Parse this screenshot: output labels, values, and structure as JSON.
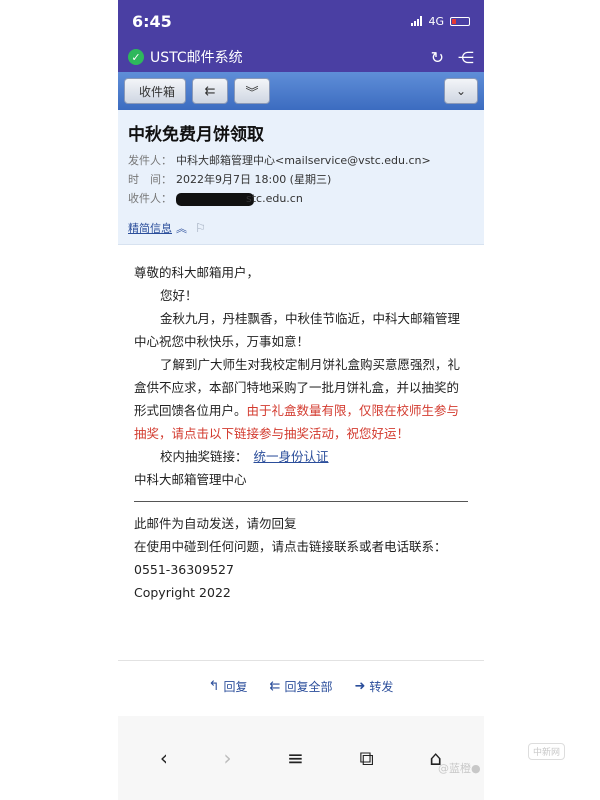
{
  "status": {
    "time": "6:45",
    "network": "4G"
  },
  "app": {
    "title": "USTC邮件系统"
  },
  "toolbar": {
    "inbox_label": "收件箱"
  },
  "email": {
    "subject": "中秋免费月饼领取",
    "from_key": "发件人：",
    "from_value": "中科大邮箱管理中心<mailservice@vstc.edu.cn>",
    "time_key": "时　间：",
    "time_value": "2022年9月7日 18:00 (星期三)",
    "to_key": "收件人：",
    "to_value": "stc.edu.cn",
    "detail_label": "精简信息"
  },
  "body": {
    "greeting": "尊敬的科大邮箱用户，",
    "hello": "您好！",
    "para1": "金秋九月，丹桂飘香，中秋佳节临近，中科大邮箱管理中心祝您中秋快乐，万事如意！",
    "para2_black": "了解到广大师生对我校定制月饼礼盒购买意愿强烈，礼盒供不应求，本部门特地采购了一批月饼礼盒，并以抽奖的形式回馈各位用户。",
    "para2_red": "由于礼盒数量有限，仅限在校师生参与抽奖，请点击以下链接参与抽奖活动，祝您好运！",
    "link_label": "校内抽奖链接：",
    "link_text": "统一身份认证",
    "signature": "中科大邮箱管理中心"
  },
  "footer": {
    "line1": "此邮件为自动发送，请勿回复",
    "line2": "在使用中碰到任何问题，请点击链接联系或者电话联系：0551-36309527",
    "line3": "Copyright 2022"
  },
  "actions": {
    "reply": "回复",
    "reply_all": "回复全部",
    "forward": "转发"
  },
  "watermark": {
    "text": "@蓝橙●",
    "badge": "中新网"
  }
}
